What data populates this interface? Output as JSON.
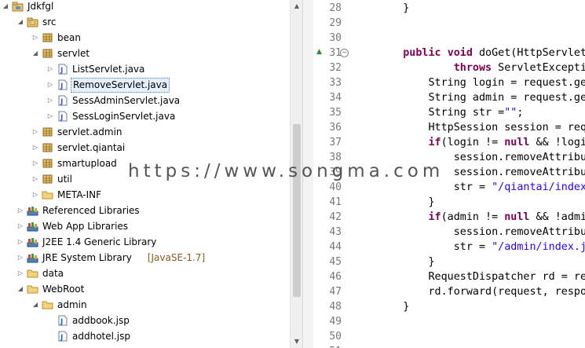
{
  "explorer": {
    "items": [
      {
        "label": "Jdkfgl",
        "depth": 0,
        "twisty": "expanded",
        "icon": "project-icon"
      },
      {
        "label": "src",
        "depth": 1,
        "twisty": "expanded",
        "icon": "source-folder-icon"
      },
      {
        "label": "bean",
        "depth": 2,
        "twisty": "collapsed",
        "icon": "package-icon"
      },
      {
        "label": "servlet",
        "depth": 2,
        "twisty": "expanded",
        "icon": "package-icon"
      },
      {
        "label": "ListServlet.java",
        "depth": 3,
        "twisty": "collapsed",
        "icon": "java-file-icon"
      },
      {
        "label": "RemoveServlet.java",
        "depth": 3,
        "twisty": "collapsed",
        "icon": "java-file-icon",
        "selected": true
      },
      {
        "label": "SessAdminServlet.java",
        "depth": 3,
        "twisty": "collapsed",
        "icon": "java-file-icon"
      },
      {
        "label": "SessLoginServlet.java",
        "depth": 3,
        "twisty": "collapsed",
        "icon": "java-file-icon"
      },
      {
        "label": "servlet.admin",
        "depth": 2,
        "twisty": "collapsed",
        "icon": "package-icon"
      },
      {
        "label": "servlet.qiantai",
        "depth": 2,
        "twisty": "collapsed",
        "icon": "package-icon"
      },
      {
        "label": "smartupload",
        "depth": 2,
        "twisty": "collapsed",
        "icon": "package-icon"
      },
      {
        "label": "util",
        "depth": 2,
        "twisty": "collapsed",
        "icon": "package-icon"
      },
      {
        "label": "META-INF",
        "depth": 2,
        "twisty": "collapsed",
        "icon": "folder-icon"
      },
      {
        "label": "Referenced Libraries",
        "depth": 1,
        "twisty": "collapsed",
        "icon": "library-icon"
      },
      {
        "label": "Web App Libraries",
        "depth": 1,
        "twisty": "collapsed",
        "icon": "library-icon"
      },
      {
        "label": "J2EE 1.4 Generic Library",
        "depth": 1,
        "twisty": "collapsed",
        "icon": "library-icon"
      },
      {
        "label": "JRE System Library",
        "depth": 1,
        "twisty": "collapsed",
        "icon": "library-icon",
        "suffix": "[JavaSE-1.7]"
      },
      {
        "label": "data",
        "depth": 1,
        "twisty": "collapsed",
        "icon": "folder-icon"
      },
      {
        "label": "WebRoot",
        "depth": 1,
        "twisty": "expanded",
        "icon": "folder-icon"
      },
      {
        "label": "admin",
        "depth": 2,
        "twisty": "expanded",
        "icon": "folder-icon"
      },
      {
        "label": "addbook.jsp",
        "depth": 3,
        "twisty": "none",
        "icon": "jsp-file-icon"
      },
      {
        "label": "addhotel.jsp",
        "depth": 3,
        "twisty": "none",
        "icon": "jsp-file-icon"
      }
    ]
  },
  "editor": {
    "lines": [
      {
        "num": "28",
        "tokens": [
          {
            "t": "    }"
          }
        ]
      },
      {
        "num": "29",
        "tokens": [
          {
            "t": ""
          }
        ]
      },
      {
        "num": "30",
        "tokens": [
          {
            "t": ""
          }
        ]
      },
      {
        "num": "31",
        "override": true,
        "fold": true,
        "tokens": [
          {
            "t": "    "
          },
          {
            "t": "public",
            "c": "kw"
          },
          {
            "t": " "
          },
          {
            "t": "void",
            "c": "kw"
          },
          {
            "t": " doGet(HttpServletRequest request, HttpServletResponse response)"
          }
        ]
      },
      {
        "num": "32",
        "tokens": [
          {
            "t": "            "
          },
          {
            "t": "throws",
            "c": "kw"
          },
          {
            "t": " ServletException, IOException {"
          }
        ]
      },
      {
        "num": "33",
        "tokens": [
          {
            "t": "        String login = request.getParameter(\"login\");"
          }
        ]
      },
      {
        "num": "34",
        "tokens": [
          {
            "t": "        String admin = request.getParameter(\"admin\");"
          }
        ]
      },
      {
        "num": "35",
        "tokens": [
          {
            "t": "        String str ="
          },
          {
            "t": "\"\"",
            "c": "str"
          },
          {
            "t": ";"
          }
        ]
      },
      {
        "num": "36",
        "tokens": [
          {
            "t": "        HttpSession session = request.getSession();"
          }
        ]
      },
      {
        "num": "37",
        "tokens": [
          {
            "t": "        "
          },
          {
            "t": "if",
            "c": "kw"
          },
          {
            "t": "(login != "
          },
          {
            "t": "null",
            "c": "kw"
          },
          {
            "t": " && !login.equals(\"\")){"
          }
        ]
      },
      {
        "num": "38",
        "tokens": [
          {
            "t": "            session.removeAttribute(\"login\");"
          }
        ]
      },
      {
        "num": "39",
        "tokens": [
          {
            "t": "            session.removeAttribute(\"user\");"
          }
        ]
      },
      {
        "num": "40",
        "tokens": [
          {
            "t": "            str = "
          },
          {
            "t": "\"/qiantai/index.jsp\"",
            "c": "str"
          },
          {
            "t": ";"
          }
        ]
      },
      {
        "num": "41",
        "tokens": [
          {
            "t": "        }"
          }
        ]
      },
      {
        "num": "42",
        "tokens": [
          {
            "t": "        "
          },
          {
            "t": "if",
            "c": "kw"
          },
          {
            "t": "(admin != "
          },
          {
            "t": "null",
            "c": "kw"
          },
          {
            "t": " && !admin.equals(\"\")){"
          }
        ]
      },
      {
        "num": "43",
        "tokens": [
          {
            "t": "            session.removeAttribute(\"admin\");"
          }
        ]
      },
      {
        "num": "44",
        "tokens": [
          {
            "t": "            str = "
          },
          {
            "t": "\"/admin/index.jsp\"",
            "c": "str"
          },
          {
            "t": ";"
          }
        ]
      },
      {
        "num": "45",
        "tokens": [
          {
            "t": "        }"
          }
        ]
      },
      {
        "num": "46",
        "tokens": [
          {
            "t": "        RequestDispatcher rd = request.getRequestDispatcher(str);"
          }
        ]
      },
      {
        "num": "47",
        "tokens": [
          {
            "t": "        rd.forward(request, response);"
          }
        ]
      },
      {
        "num": "48",
        "tokens": [
          {
            "t": "    }"
          }
        ]
      },
      {
        "num": "49",
        "tokens": [
          {
            "t": ""
          }
        ]
      },
      {
        "num": "50",
        "tokens": [
          {
            "t": ""
          }
        ]
      },
      {
        "num": "51",
        "tokens": [
          {
            "t": ""
          }
        ]
      }
    ]
  },
  "watermark": "https://www.songma.com",
  "colors": {
    "keyword": "#7f0055",
    "string": "#2a00ff",
    "line_number": "#787878",
    "selection": "#e5f0fb"
  }
}
